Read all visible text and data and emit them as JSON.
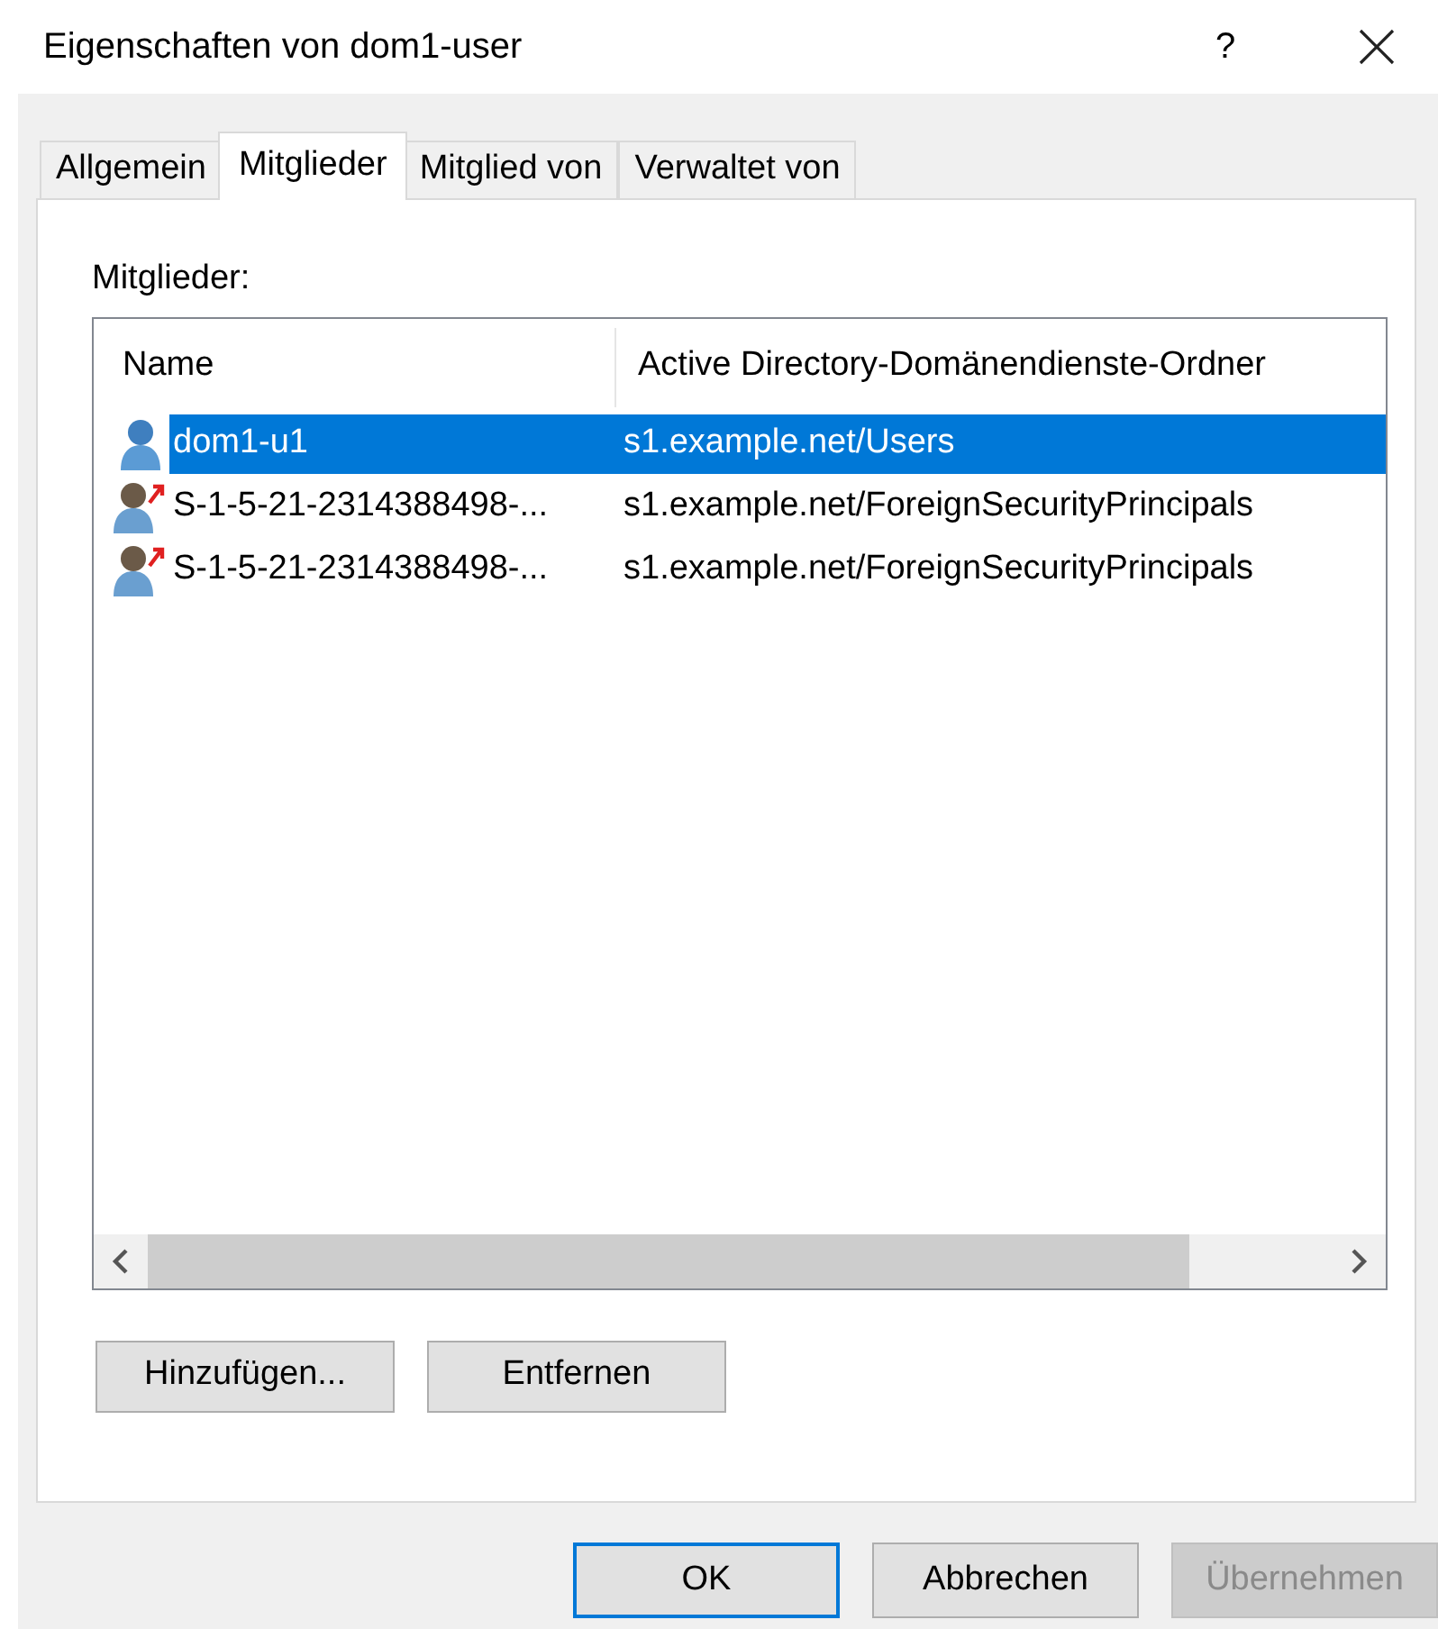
{
  "window": {
    "title": "Eigenschaften von dom1-user",
    "help": "?"
  },
  "tabs": [
    {
      "label": "Allgemein",
      "selected": false
    },
    {
      "label": "Mitglieder",
      "selected": true
    },
    {
      "label": "Mitglied von",
      "selected": false
    },
    {
      "label": "Verwaltet von",
      "selected": false
    }
  ],
  "members_label": "Mitglieder:",
  "table": {
    "columns": [
      "Name",
      "Active Directory-Domänendienste-Ordner"
    ],
    "rows": [
      {
        "kind": "user",
        "name": "dom1-u1",
        "folder": "s1.example.net/Users",
        "selected": true
      },
      {
        "kind": "foreign",
        "name": "S-1-5-21-2314388498-...",
        "folder": "s1.example.net/ForeignSecurityPrincipals",
        "selected": false
      },
      {
        "kind": "foreign",
        "name": "S-1-5-21-2314388498-...",
        "folder": "s1.example.net/ForeignSecurityPrincipals",
        "selected": false
      }
    ]
  },
  "list_buttons": [
    "Hinzufügen...",
    "Entfernen"
  ],
  "dialog_buttons": [
    {
      "label": "OK",
      "focused": true,
      "disabled": false
    },
    {
      "label": "Abbrechen",
      "focused": false,
      "disabled": false
    },
    {
      "label": "Übernehmen",
      "focused": false,
      "disabled": true
    }
  ]
}
